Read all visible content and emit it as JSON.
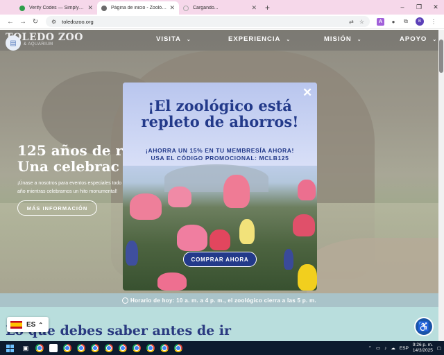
{
  "browser": {
    "tabs": [
      {
        "title": "Verify Codes — SimplyCodes",
        "favicon_color": "#2e9e4a",
        "active": false
      },
      {
        "title": "Página de inicio - Zoológico y acuario de Toledo",
        "favicon_color": "#6b6b6b",
        "active": true
      },
      {
        "title": "Cargando...",
        "favicon_color": "#aaaaaa",
        "active": false
      }
    ],
    "new_tab": "+",
    "window_controls": [
      "–",
      "❐",
      "✕"
    ],
    "url": "toledozoo.org",
    "extension_letter": "A",
    "profile_initial": "B"
  },
  "site": {
    "logo": "TOLEDO ZOO",
    "logo_sub": "& AQUARIUM",
    "nav": [
      "VISITA",
      "EXPERIENCIA",
      "MISIÓN",
      "APOYO"
    ],
    "hero_heading_1": "125 años de re",
    "hero_heading_2": "Una celebrac",
    "hero_text": "¡Únase a nosotros para eventos especiales todo el año mientras celebramos un hito monumental!",
    "hero_button": "MÁS INFORMACIÓN",
    "hours": "Horario de hoy: 10 a. m. a 4 p. m., el zoológico cierra a las 5 p. m.",
    "section_heading": "Lo que debes saber antes de ir",
    "language_code": "ES"
  },
  "modal": {
    "title": "¡El zoológico está repleto de ahorros!",
    "line1": "¡AHORRA UN 15% EN TU MEMBRESÍA AHORA!",
    "line2": "USA EL CÓDIGO PROMOCIONAL: MCLB125",
    "cta": "COMPRAR AHORA",
    "close": "✕"
  },
  "taskbar": {
    "lang": "ESP",
    "time": "9:26 p. m.",
    "date": "14/3/2025"
  }
}
